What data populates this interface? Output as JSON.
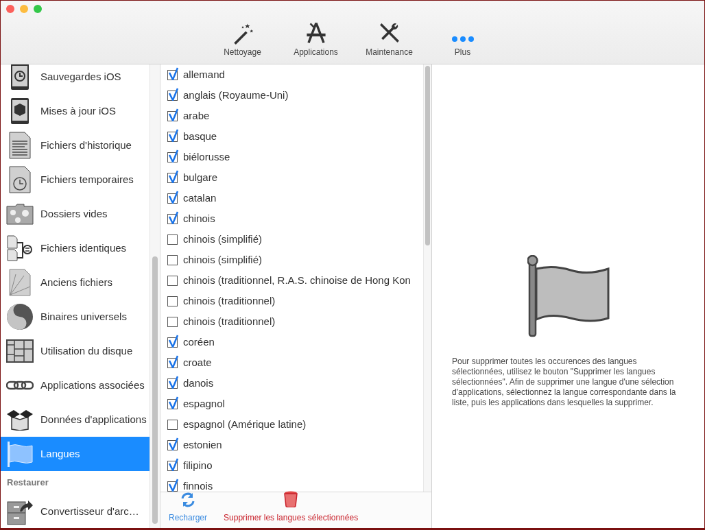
{
  "toolbar": {
    "items": [
      {
        "label": "Nettoyage"
      },
      {
        "label": "Applications"
      },
      {
        "label": "Maintenance"
      },
      {
        "label": "Plus"
      }
    ]
  },
  "sidebar": {
    "items": [
      {
        "label": "Sauvegardes iOS",
        "selected": false
      },
      {
        "label": "Mises à jour iOS",
        "selected": false
      },
      {
        "label": "Fichiers d'historique",
        "selected": false
      },
      {
        "label": "Fichiers temporaires",
        "selected": false
      },
      {
        "label": "Dossiers vides",
        "selected": false
      },
      {
        "label": "Fichiers identiques",
        "selected": false
      },
      {
        "label": "Anciens fichiers",
        "selected": false
      },
      {
        "label": "Binaires universels",
        "selected": false
      },
      {
        "label": "Utilisation du disque",
        "selected": false
      },
      {
        "label": "Applications associées",
        "selected": false
      },
      {
        "label": "Données d'applications",
        "selected": false
      },
      {
        "label": "Langues",
        "selected": true
      }
    ],
    "section": "Restaurer",
    "section_items": [
      {
        "label": "Convertisseur d'arc…",
        "selected": false
      }
    ]
  },
  "languages": [
    {
      "label": "allemand",
      "checked": true
    },
    {
      "label": "anglais (Royaume-Uni)",
      "checked": true
    },
    {
      "label": "arabe",
      "checked": true
    },
    {
      "label": "basque",
      "checked": true
    },
    {
      "label": "biélorusse",
      "checked": true
    },
    {
      "label": "bulgare",
      "checked": true
    },
    {
      "label": "catalan",
      "checked": true
    },
    {
      "label": "chinois",
      "checked": true
    },
    {
      "label": "chinois (simplifié)",
      "checked": false
    },
    {
      "label": "chinois (simplifié)",
      "checked": false
    },
    {
      "label": "chinois (traditionnel, R.A.S. chinoise de Hong Kon",
      "checked": false
    },
    {
      "label": "chinois (traditionnel)",
      "checked": false
    },
    {
      "label": "chinois (traditionnel)",
      "checked": false
    },
    {
      "label": "coréen",
      "checked": true
    },
    {
      "label": "croate",
      "checked": true
    },
    {
      "label": "danois",
      "checked": true
    },
    {
      "label": "espagnol",
      "checked": true
    },
    {
      "label": "espagnol (Amérique latine)",
      "checked": false
    },
    {
      "label": "estonien",
      "checked": true
    },
    {
      "label": "filipino",
      "checked": true
    },
    {
      "label": "finnois",
      "checked": true
    }
  ],
  "footer": {
    "reload": "Recharger",
    "remove": "Supprimer les langues sélectionnées"
  },
  "info": "Pour supprimer toutes les occurences des langues sélectionnées, utilisez le bouton \"Supprimer les langues sélectionnées\". Afin de supprimer une langue d'une sélection d'applications, sélectionnez la langue correspondante dans la liste, puis les applications dans lesquelles la supprimer."
}
